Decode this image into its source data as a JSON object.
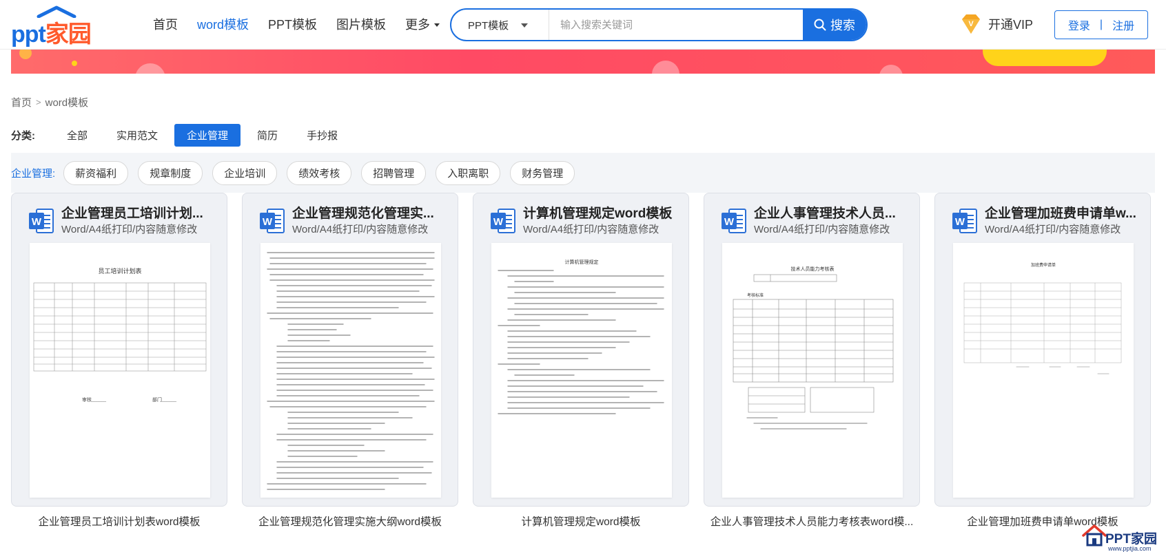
{
  "logo": {
    "latin": "ppt",
    "cn": "家园"
  },
  "nav": [
    {
      "label": "首页",
      "active": false
    },
    {
      "label": "word模板",
      "active": true
    },
    {
      "label": "PPT模板",
      "active": false
    },
    {
      "label": "图片模板",
      "active": false
    },
    {
      "label": "更多",
      "active": false,
      "dropdown": true
    }
  ],
  "search": {
    "type_selected": "PPT模板",
    "placeholder": "输入搜索关键词",
    "button_label": "搜索"
  },
  "vip": {
    "label": "开通VIP",
    "badge": "V"
  },
  "auth": {
    "login": "登录",
    "separator": "|",
    "register": "注册"
  },
  "breadcrumb": {
    "home": "首页",
    "separator": ">",
    "current": "word模板"
  },
  "categories": {
    "label": "分类:",
    "items": [
      {
        "label": "全部",
        "active": false
      },
      {
        "label": "实用范文",
        "active": false
      },
      {
        "label": "企业管理",
        "active": true
      },
      {
        "label": "简历",
        "active": false
      },
      {
        "label": "手抄报",
        "active": false
      }
    ]
  },
  "subcategories": {
    "label": "企业管理:",
    "items": [
      "薪资福利",
      "规章制度",
      "企业培训",
      "绩效考核",
      "招聘管理",
      "入职离职",
      "财务管理"
    ]
  },
  "cards": [
    {
      "title": "企业管理员工培训计划...",
      "subtitle": "Word/A4纸打印/内容随意修改",
      "caption": "企业管理员工培训计划表word模板",
      "preview": "table"
    },
    {
      "title": "企业管理规范化管理实...",
      "subtitle": "Word/A4纸打印/内容随意修改",
      "caption": "企业管理规范化管理实施大纲word模板",
      "preview": "text"
    },
    {
      "title": "计算机管理规定word模板",
      "subtitle": "Word/A4纸打印/内容随意修改",
      "caption": "计算机管理规定word模板",
      "preview": "text2"
    },
    {
      "title": "企业人事管理技术人员...",
      "subtitle": "Word/A4纸打印/内容随意修改",
      "caption": "企业人事管理技术人员能力考核表word模...",
      "preview": "form"
    },
    {
      "title": "企业管理加班费申请单w...",
      "subtitle": "Word/A4纸打印/内容随意修改",
      "caption": "企业管理加班费申请单word模板",
      "preview": "sheet"
    }
  ],
  "preview_text": {
    "card1_heading": "员工培训计划表",
    "card1_footer_left": "审核______",
    "card1_footer_right": "部门______",
    "card3_heading": "计算机管理规定",
    "card4_heading": "技术人员能力考核表",
    "card4_subheading": "考核标准",
    "card5_heading": "加班费申请单"
  },
  "watermark": {
    "text": "PPT家园",
    "url": "www.pptjia.com"
  },
  "colors": {
    "accent": "#1a6fe0",
    "logo_orange": "#ff5a2c",
    "vip_gold": "#f5a623",
    "banner": "#ff5064"
  }
}
